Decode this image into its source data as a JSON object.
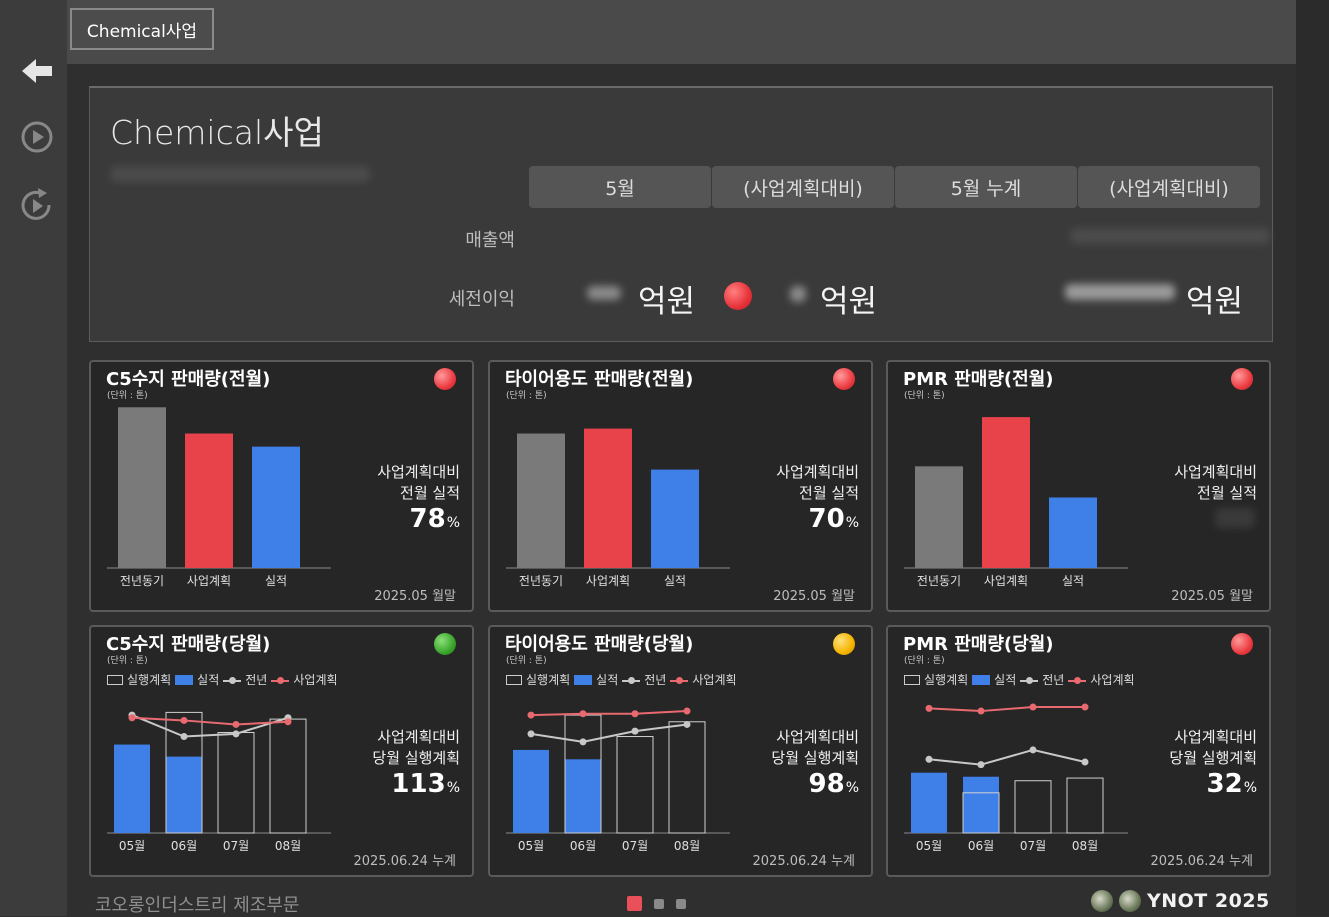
{
  "header": {
    "tab_label": "Chemical사업"
  },
  "nav": {
    "back": "back-arrow-icon",
    "play": "play-icon",
    "refresh": "refresh-play-icon"
  },
  "summary": {
    "title": "Chemical사업",
    "columns": [
      "5월",
      "(사업계획대비)",
      "5월 누계",
      "(사업계획대비)"
    ],
    "rows": {
      "sales": "매출액",
      "profit": "세전이익"
    },
    "unit": "억원",
    "status_color": "#e8323a"
  },
  "cards_prev": [
    {
      "title": "C5수지 판매량(전월)",
      "unit": "(단위 : 톤)",
      "status": "red",
      "label1": "사업계획대비",
      "label2": "전월 실적",
      "value": "78",
      "pct": "%",
      "footer": "2025.05 월말",
      "categories": [
        "전년동기",
        "사업계획",
        "실적"
      ],
      "bar_values": [
        0.98,
        0.82,
        0.74
      ]
    },
    {
      "title": "타이어용도 판매량(전월)",
      "unit": "(단위 : 톤)",
      "status": "red",
      "label1": "사업계획대비",
      "label2": "전월 실적",
      "value": "70",
      "pct": "%",
      "footer": "2025.05 월말",
      "categories": [
        "전년동기",
        "사업계획",
        "실적"
      ],
      "bar_values": [
        0.82,
        0.85,
        0.6
      ]
    },
    {
      "title": "PMR 판매량(전월)",
      "unit": "(단위 : 톤)",
      "status": "red",
      "label1": "사업계획대비",
      "label2": "전월 실적",
      "value": "",
      "pct": "",
      "footer": "2025.05 월말",
      "categories": [
        "전년동기",
        "사업계획",
        "실적"
      ],
      "bar_values": [
        0.62,
        0.92,
        0.43
      ]
    }
  ],
  "cards_curr": [
    {
      "title": "C5수지 판매량(당월)",
      "unit": "(단위 : 톤)",
      "status": "green",
      "label1": "사업계획대비",
      "label2": "당월 실행계획",
      "value": "113",
      "pct": "%",
      "footer": "2025.06.24 누계",
      "legend": [
        "실행계획",
        "실적",
        "전년",
        "사업계획"
      ],
      "months": [
        "05월",
        "06월",
        "07월",
        "08월"
      ],
      "plan": [
        null,
        0.9,
        0.75,
        0.85
      ],
      "actual": [
        0.66,
        0.57,
        null,
        null
      ],
      "prev": [
        0.88,
        0.72,
        0.74,
        0.86
      ],
      "biz": [
        0.86,
        0.84,
        0.81,
        0.83
      ]
    },
    {
      "title": "타이어용도 판매량(당월)",
      "unit": "(단위 : 톤)",
      "status": "yellow",
      "label1": "사업계획대비",
      "label2": "당월 실행계획",
      "value": "98",
      "pct": "%",
      "footer": "2025.06.24 누계",
      "legend": [
        "실행계획",
        "실적",
        "전년",
        "사업계획"
      ],
      "months": [
        "05월",
        "06월",
        "07월",
        "08월"
      ],
      "plan": [
        null,
        0.88,
        0.72,
        0.83
      ],
      "actual": [
        0.62,
        0.55,
        null,
        null
      ],
      "prev": [
        0.74,
        0.68,
        0.76,
        0.81
      ],
      "biz": [
        0.88,
        0.89,
        0.89,
        0.91
      ]
    },
    {
      "title": "PMR 판매량(당월)",
      "unit": "(단위 : 톤)",
      "status": "red",
      "label1": "사업계획대비",
      "label2": "당월 실행계획",
      "value": "32",
      "pct": "%",
      "footer": "2025.06.24 누계",
      "legend": [
        "실행계획",
        "실적",
        "전년",
        "사업계획"
      ],
      "months": [
        "05월",
        "06월",
        "07월",
        "08월"
      ],
      "plan": [
        null,
        0.3,
        0.39,
        0.41
      ],
      "actual": [
        0.45,
        0.42,
        null,
        null
      ],
      "prev": [
        0.55,
        0.51,
        0.62,
        0.53
      ],
      "biz": [
        0.93,
        0.91,
        0.94,
        0.94
      ]
    }
  ],
  "colors": {
    "prev_bar": "#7a7a7a",
    "plan_bar": "#e8434b",
    "actual_bar": "#3f7fe8",
    "prev_line": "#c8c8c8",
    "biz_line": "#e86a70"
  },
  "footer": {
    "company": "코오롱인더스트리 제조부문",
    "brand": "YNOT 2025"
  }
}
